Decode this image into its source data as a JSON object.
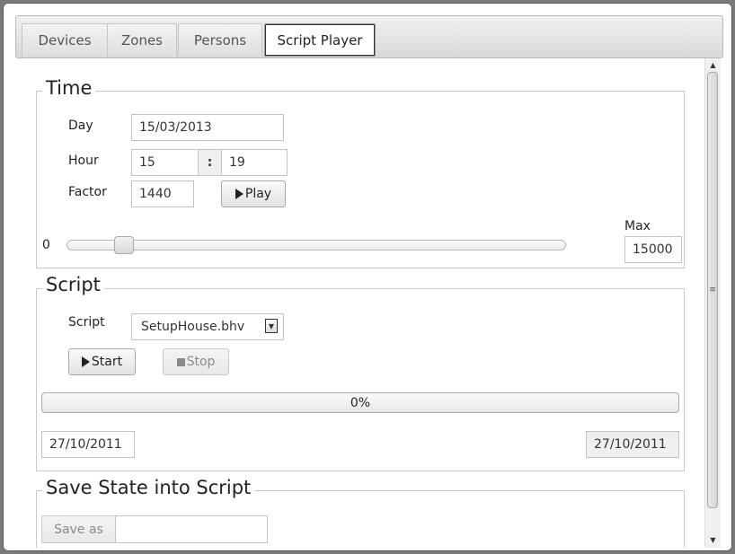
{
  "tabs": [
    {
      "label": "Devices",
      "active": false
    },
    {
      "label": "Zones",
      "active": false
    },
    {
      "label": "Persons",
      "active": false
    },
    {
      "label": "Script Player",
      "active": true
    }
  ],
  "time": {
    "legend": "Time",
    "day_label": "Day",
    "day_value": "15/03/2013",
    "hour_label": "Hour",
    "hour_value": "15",
    "hour_separator": ":",
    "minute_value": "19",
    "factor_label": "Factor",
    "factor_value": "1440",
    "play_label": "Play",
    "slider_min": "0",
    "slider_max_label": "Max",
    "slider_max_value": "15000",
    "slider_fraction": 0.1
  },
  "script": {
    "legend": "Script",
    "script_label": "Script",
    "script_value": "SetupHouse.bhv",
    "start_label": "Start",
    "stop_label": "Stop",
    "progress_text": "0%",
    "progress_fraction": 0,
    "start_date": "27/10/2011",
    "end_date": "27/10/2011"
  },
  "save_state": {
    "legend": "Save State into Script",
    "save_as_label": "Save as",
    "save_as_value": ""
  },
  "colors": {
    "progress_fill": "#9ac3ea"
  }
}
